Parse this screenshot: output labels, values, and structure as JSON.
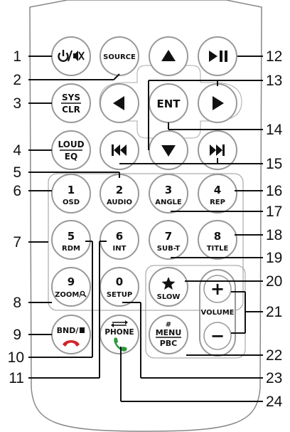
{
  "buttons": {
    "source": "SOURCE",
    "ent": "ENT",
    "sys_top": "SYS",
    "sys_bottom": "CLR",
    "loud_top": "LOUD",
    "loud_bottom": "EQ",
    "b1_num": "1",
    "b1_label": "OSD",
    "b2_num": "2",
    "b2_label": "AUDIO",
    "b3_num": "3",
    "b3_label": "ANGLE",
    "b4_num": "4",
    "b4_label": "REP",
    "b5_num": "5",
    "b5_label": "RDM",
    "b6_num": "6",
    "b6_label": "INT",
    "b7_num": "7",
    "b7_label": "SUB-T",
    "b8_num": "8",
    "b8_label": "TITLE",
    "b9_num": "9",
    "b9_label": "ZOOM/",
    "b0_num": "0",
    "b0_label": "SETUP",
    "slow": "SLOW",
    "volume": "VOLUME",
    "band": "BND/",
    "phone": "PHONE",
    "menu_hash": "#",
    "menu_top": "MENU",
    "menu_bottom": "PBC",
    "vol_plus": "+",
    "vol_minus": "−"
  },
  "callouts": {
    "c1": "1",
    "c2": "2",
    "c3": "3",
    "c4": "4",
    "c5": "5",
    "c6": "6",
    "c7": "7",
    "c8": "8",
    "c9": "9",
    "c10": "10",
    "c11": "11",
    "c12": "12",
    "c13": "13",
    "c14": "14",
    "c15": "15",
    "c16": "16",
    "c17": "17",
    "c18": "18",
    "c19": "19",
    "c20": "20",
    "c21": "21",
    "c22": "22",
    "c23": "23",
    "c24": "24"
  }
}
